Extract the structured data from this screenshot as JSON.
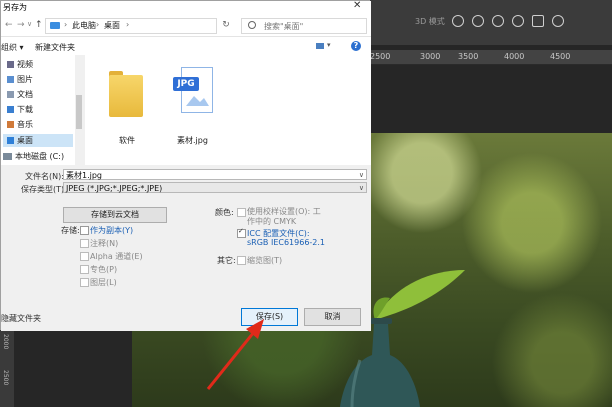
{
  "photoshop": {
    "ruler_ticks": [
      "2500",
      "3000",
      "3500",
      "4000",
      "4500"
    ],
    "left_ruler_ticks": [
      "2000",
      "2500"
    ],
    "mode_label": "3D 模式"
  },
  "dialog": {
    "title": "另存为",
    "close_label": "✕",
    "breadcrumbs": [
      "此电脑",
      "桌面"
    ],
    "search_placeholder": "搜索\"桌面\"",
    "organize_label": "组织 ▾",
    "new_folder_label": "新建文件夹",
    "nav_items": [
      {
        "label": "视频",
        "icon": "video-icon"
      },
      {
        "label": "图片",
        "icon": "pictures-icon"
      },
      {
        "label": "文档",
        "icon": "documents-icon"
      },
      {
        "label": "下载",
        "icon": "download-icon"
      },
      {
        "label": "音乐",
        "icon": "music-icon"
      },
      {
        "label": "桌面",
        "icon": "desktop-icon"
      },
      {
        "label": "本地磁盘 (C:)",
        "icon": "disk-icon"
      }
    ],
    "selected_nav": "桌面",
    "files": [
      {
        "name": "软件",
        "type": "folder"
      },
      {
        "name": "素材.jpg",
        "type": "jpg",
        "badge": "JPG"
      }
    ],
    "filename_label": "文件名(N):",
    "filename_value": "素材1.jpg",
    "filetype_label": "保存类型(T):",
    "filetype_value": "JPEG (*.JPG;*.JPEG;*.JPE)",
    "cloud_button": "存储到云文档",
    "storage_label": "存储:",
    "storage_options": [
      {
        "label": "作为副本(Y)",
        "checked": false,
        "enabled": true
      },
      {
        "label": "注释(N)",
        "checked": false,
        "enabled": false
      },
      {
        "label": "Alpha 通道(E)",
        "checked": false,
        "enabled": false
      },
      {
        "label": "专色(P)",
        "checked": false,
        "enabled": false
      },
      {
        "label": "图层(L)",
        "checked": false,
        "enabled": false
      }
    ],
    "color_label": "颜色:",
    "proof_label": "使用校样设置(O): 工作中的 CMYK",
    "icc_label": "ICC 配置文件(C):",
    "icc_value": "sRGB IEC61966-2.1",
    "icc_checked": true,
    "other_label": "其它:",
    "thumbnail_label": "缩览图(T)",
    "save_button": "保存(S)",
    "cancel_button": "取消",
    "hide_folders_label": "隐藏文件夹"
  },
  "colors": {
    "accent": "#0078d7",
    "arrow": "#e02a1a"
  }
}
